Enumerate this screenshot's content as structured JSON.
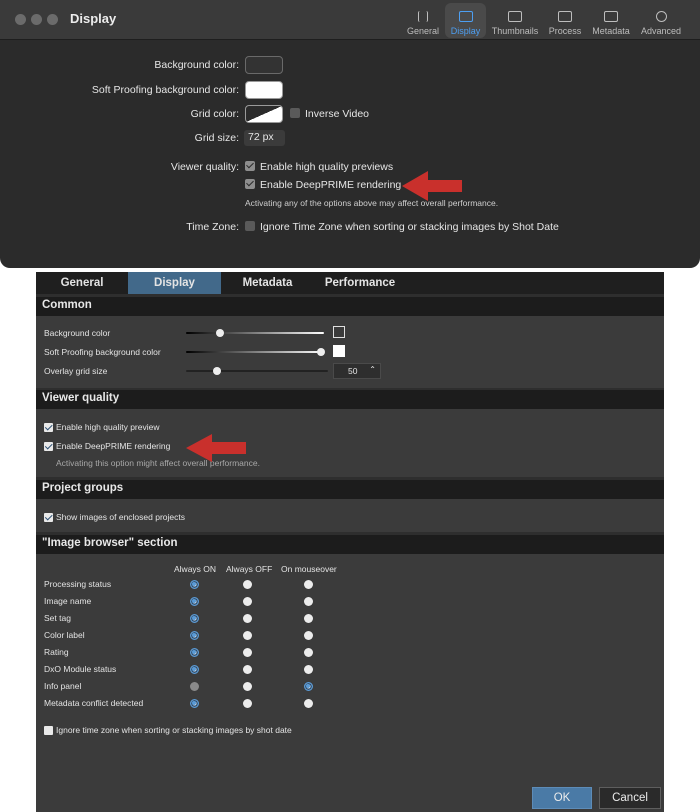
{
  "mac_window": {
    "title": "Display",
    "toolbar": [
      {
        "label": "General",
        "icon": "sliders-icon",
        "active": false
      },
      {
        "label": "Display",
        "icon": "monitor-icon",
        "active": true
      },
      {
        "label": "Thumbnails",
        "icon": "thumbnails-icon",
        "active": false
      },
      {
        "label": "Process",
        "icon": "process-icon",
        "active": false
      },
      {
        "label": "Metadata",
        "icon": "metadata-icon",
        "active": false
      },
      {
        "label": "Advanced",
        "icon": "gear-icon",
        "active": false
      }
    ],
    "background_color_label": "Background color:",
    "soft_proofing_label": "Soft Proofing background color:",
    "grid_color_label": "Grid color:",
    "inverse_video_label": "Inverse Video",
    "grid_size_label": "Grid size:",
    "grid_size_value": "72 px",
    "viewer_quality_label": "Viewer quality:",
    "high_quality_label": "Enable high quality previews",
    "deepprime_label": "Enable DeepPRIME rendering",
    "performance_note": "Activating any of the options above may affect overall performance.",
    "time_zone_label": "Time Zone:",
    "time_zone_option": "Ignore Time Zone when sorting or stacking images by Shot Date",
    "colors": {
      "background_swatch": "#333333",
      "soft_proof_swatch": "#ffffff",
      "accent": "#4d9ff2"
    }
  },
  "win_window": {
    "tabs": [
      {
        "label": "General",
        "active": false
      },
      {
        "label": "Display",
        "active": true
      },
      {
        "label": "Metadata",
        "active": false
      },
      {
        "label": "Performance",
        "active": false
      }
    ],
    "common": {
      "title": "Common",
      "background_color_label": "Background color",
      "soft_proofing_label": "Soft Proofing background color",
      "overlay_grid_label": "Overlay grid size",
      "overlay_grid_value": "50"
    },
    "viewer_quality": {
      "title": "Viewer quality",
      "high_quality_label": "Enable high quality preview",
      "deepprime_label": "Enable DeepPRIME rendering",
      "note": "Activating this option might affect overall performance."
    },
    "project_groups": {
      "title": "Project groups",
      "show_enclosed_label": "Show images of enclosed projects"
    },
    "image_browser": {
      "title": "\"Image browser\" section",
      "columns": [
        "Always ON",
        "Always OFF",
        "On mouseover"
      ],
      "rows": [
        {
          "label": "Processing status",
          "selected": 0
        },
        {
          "label": "Image name",
          "selected": 0
        },
        {
          "label": "Set tag",
          "selected": 0
        },
        {
          "label": "Color label",
          "selected": 0
        },
        {
          "label": "Rating",
          "selected": 0
        },
        {
          "label": "DxO Module status",
          "selected": 0
        },
        {
          "label": "Info panel",
          "selected": 2
        },
        {
          "label": "Metadata conflict detected",
          "selected": 0
        }
      ],
      "ignore_timezone_label": "Ignore time zone when sorting or stacking images by shot date"
    },
    "buttons": {
      "ok": "OK",
      "cancel": "Cancel"
    },
    "colors": {
      "active_tab": "#42698a",
      "ok_button": "#4a7aa6"
    }
  },
  "annotations": {
    "arrow_color": "#c9302c"
  }
}
